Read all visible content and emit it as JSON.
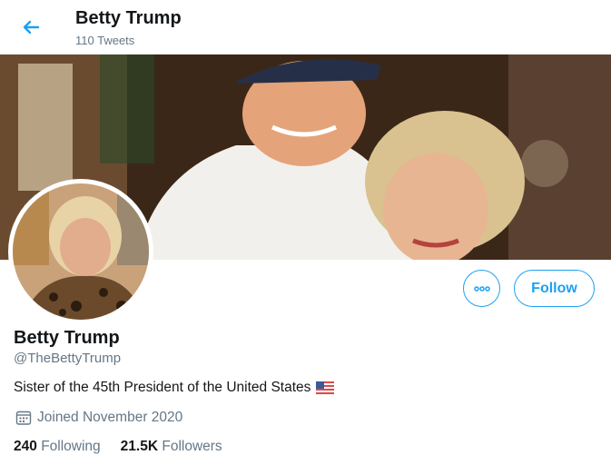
{
  "header": {
    "title": "Betty Trump",
    "tweet_count": "110 Tweets",
    "back_icon": "arrow-left-icon"
  },
  "profile": {
    "name": "Betty Trump",
    "handle": "@TheBettyTrump",
    "bio": "Sister of the 45th President of the United States",
    "joined": "Joined November 2020",
    "following_count": "240",
    "following_label": "Following",
    "followers_count": "21.5K",
    "followers_label": "Followers"
  },
  "actions": {
    "follow_label": "Follow",
    "more_icon": "more-options-icon"
  },
  "colors": {
    "accent": "#1da1f2",
    "secondary_text": "#657786",
    "primary_text": "#14171a"
  }
}
